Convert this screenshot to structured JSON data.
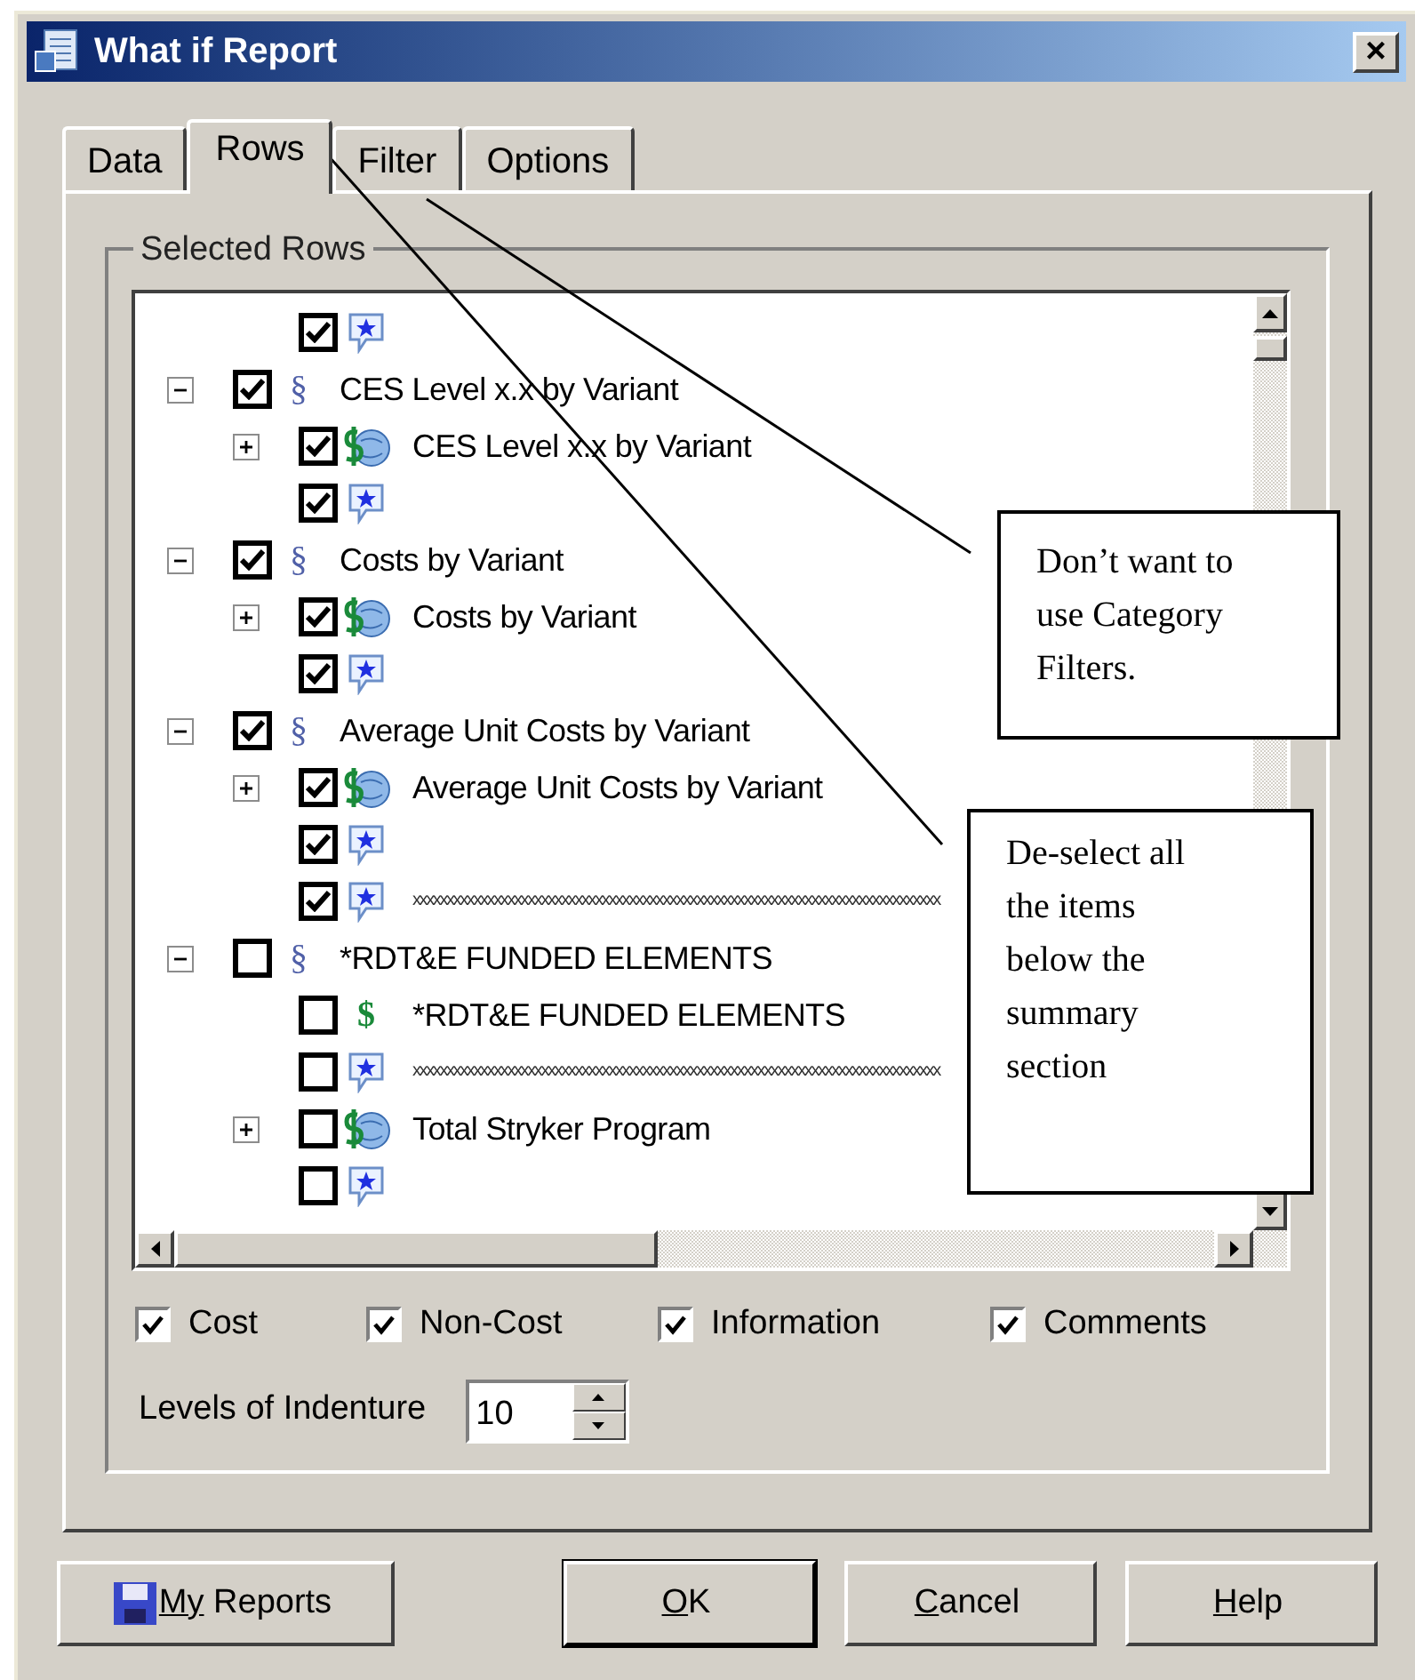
{
  "window": {
    "title": "What if Report",
    "close": "×"
  },
  "tabs": [
    {
      "label": "Data",
      "selected": false
    },
    {
      "label": "Rows",
      "selected": true
    },
    {
      "label": "Filter",
      "selected": false
    },
    {
      "label": "Options",
      "selected": false
    }
  ],
  "group": {
    "title": "Selected Rows"
  },
  "tree": {
    "leading": [
      {
        "kind": "comment",
        "checked": true
      }
    ],
    "sections": [
      {
        "label": "CES Level x.x by Variant",
        "glyph": "§",
        "checked": true,
        "expanded": true,
        "children": [
          {
            "kind": "cost",
            "label": "CES Level x.x by Variant",
            "checked": true,
            "expanded": false
          },
          {
            "kind": "comment",
            "checked": true
          }
        ]
      },
      {
        "label": "Costs by Variant",
        "glyph": "§",
        "checked": true,
        "expanded": true,
        "children": [
          {
            "kind": "cost",
            "label": "Costs by Variant",
            "checked": true,
            "expanded": false
          },
          {
            "kind": "comment",
            "checked": true
          }
        ]
      },
      {
        "label": "Average Unit Costs by Variant",
        "glyph": "§",
        "checked": true,
        "expanded": true,
        "children": [
          {
            "kind": "cost",
            "label": "Average Unit Costs by Variant",
            "checked": true,
            "expanded": false
          },
          {
            "kind": "comment",
            "checked": true
          },
          {
            "kind": "comment",
            "label": "xxxxxxxxxxxxxxxxxxxxxxxxxxxxxxxxxxxxxxxxxxxxxxxxxxxxxxxxxxxxxxxxxxxxxxxxxxxxxx",
            "checked": true
          }
        ]
      },
      {
        "label": "*RDT&E FUNDED ELEMENTS",
        "glyph": "§",
        "checked": false,
        "expanded": true,
        "children": [
          {
            "kind": "noncost",
            "glyph": "$",
            "label": "*RDT&E FUNDED ELEMENTS",
            "checked": false
          },
          {
            "kind": "comment",
            "label": "xxxxxxxxxxxxxxxxxxxxxxxxxxxxxxxxxxxxxxxxxxxxxxxxxxxxxxxxxxxxxxxxxxxxxxxxxxxxxx",
            "checked": false
          },
          {
            "kind": "cost",
            "label": "Total Stryker Program",
            "checked": false,
            "expanded": false
          },
          {
            "kind": "comment",
            "checked": false
          }
        ]
      }
    ]
  },
  "filters": [
    {
      "label": "Cost",
      "checked": true
    },
    {
      "label": "Non-Cost",
      "checked": true
    },
    {
      "label": "Information",
      "checked": true
    },
    {
      "label": "Comments",
      "checked": true
    }
  ],
  "indenture": {
    "label": "Levels of Indenture",
    "value": "10"
  },
  "buttons": [
    {
      "kind": "save",
      "label": "My Reports",
      "default": false
    },
    {
      "kind": "plain",
      "label": "OK",
      "default": true
    },
    {
      "kind": "plain",
      "label": "Cancel",
      "default": false
    },
    {
      "kind": "plain",
      "label": "Help",
      "default": false
    }
  ],
  "callouts": [
    {
      "text": "Don’t want to use Category Filters."
    },
    {
      "text": "De-select all the items below the summary section"
    }
  ]
}
